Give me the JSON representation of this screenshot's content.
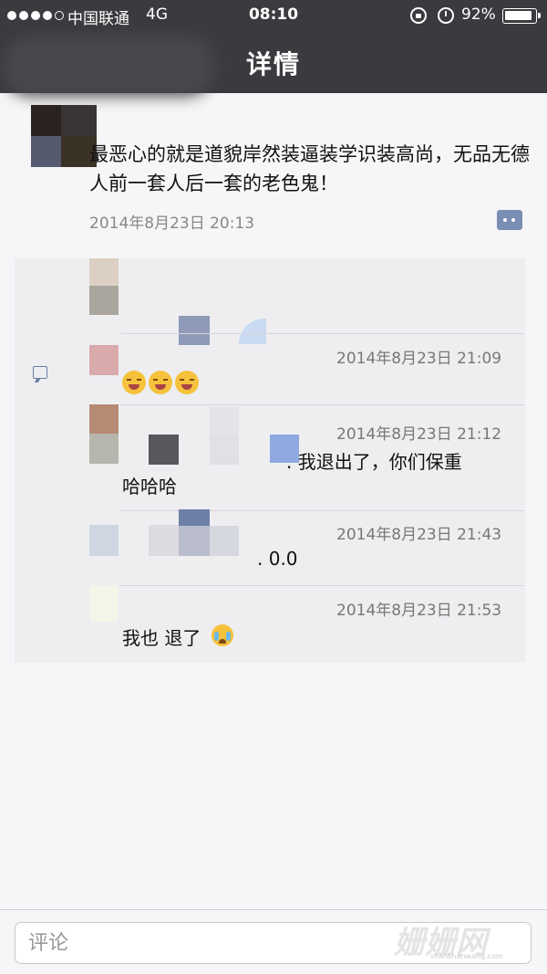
{
  "status_bar": {
    "carrier": "中国联通",
    "network": "4G",
    "time": "08:10",
    "battery": "92%",
    "battery_level": 0.92
  },
  "nav": {
    "title": "详情"
  },
  "post": {
    "text": "最恶心的就是道貌岸然装逼装学识装高尚，无品无德人前一套人后一套的老色鬼！",
    "time": "2014年8月23日 20:13"
  },
  "comments": [
    {
      "time": "2014年8月23日 21:09",
      "text": "",
      "emojis": [
        "laughing-crying-emoji",
        "laughing-crying-emoji",
        "laughing-crying-emoji"
      ]
    },
    {
      "time": "2014年8月23日 21:12",
      "text_right": ". 我退出了，你们保重",
      "text_line2": "哈哈哈"
    },
    {
      "time": "2014年8月23日 21:43",
      "text": ". 0.0"
    },
    {
      "time": "2014年8月23日 21:53",
      "text": "我也 退了",
      "emoji": "crying-emoji"
    }
  ],
  "input": {
    "placeholder": "评论"
  },
  "watermark": {
    "text": "姗姗网",
    "sub": "shanshanwang.com"
  },
  "colors": {
    "nav_bg": "#3b3b3f",
    "page_bg": "#f6f6f8",
    "comments_bg": "#eeeef1",
    "accent": "#7a8eb4"
  }
}
